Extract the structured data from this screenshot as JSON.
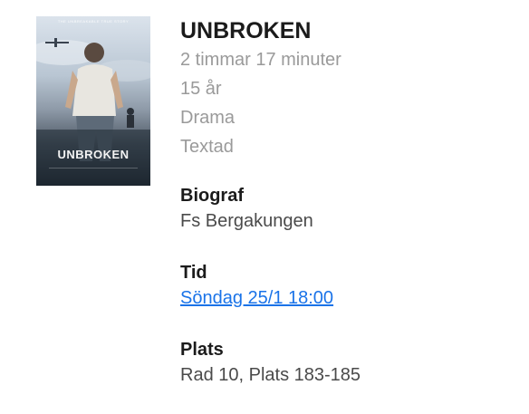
{
  "movie": {
    "title": "UNBROKEN",
    "duration": "2 timmar 17 minuter",
    "age_rating": "15 år",
    "genre": "Drama",
    "subtitle_info": "Textad"
  },
  "poster": {
    "title": "UNBROKEN",
    "tagline": "THE UNBREAKABLE TRUE STORY"
  },
  "cinema": {
    "label": "Biograf",
    "value": "Fs Bergakungen"
  },
  "time": {
    "label": "Tid",
    "value": "Söndag 25/1 18:00"
  },
  "seat": {
    "label": "Plats",
    "value": "Rad 10, Plats 183-185"
  },
  "colors": {
    "link": "#1a73e8",
    "meta_text": "#9a9a9a",
    "heading": "#1b1b1b"
  }
}
